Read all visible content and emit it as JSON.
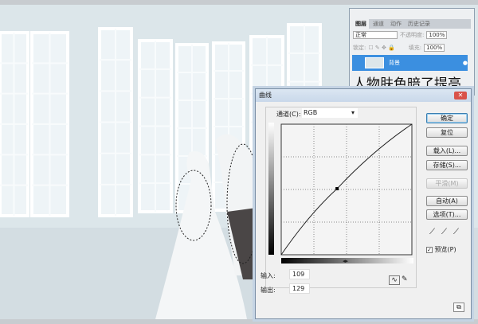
{
  "layers_panel": {
    "tabs": [
      "图层",
      "通道",
      "动作",
      "历史记录"
    ],
    "active_tab": 0,
    "blend_mode": "正常",
    "opacity_label": "不透明度:",
    "opacity": "100%",
    "lock_label": "锁定:",
    "fill_label": "填充:",
    "fill": "100%",
    "layer_name": "背景"
  },
  "caption": "人物肤色暗了提亮",
  "curves": {
    "title": "曲线",
    "channel_label": "通道(C):",
    "channel": "RGB",
    "buttons": {
      "ok": "确定",
      "reset": "复位",
      "load": "载入(L)...",
      "save": "存储(S)...",
      "smooth": "平滑(M)",
      "auto": "自动(A)",
      "options": "选项(T)..."
    },
    "preview_label": "预览(P)",
    "preview_checked": true,
    "input_label": "输入:",
    "input": "109",
    "output_label": "输出:",
    "output": "129",
    "curve_points": [
      [
        0,
        0
      ],
      [
        109,
        129
      ],
      [
        255,
        255
      ]
    ]
  }
}
